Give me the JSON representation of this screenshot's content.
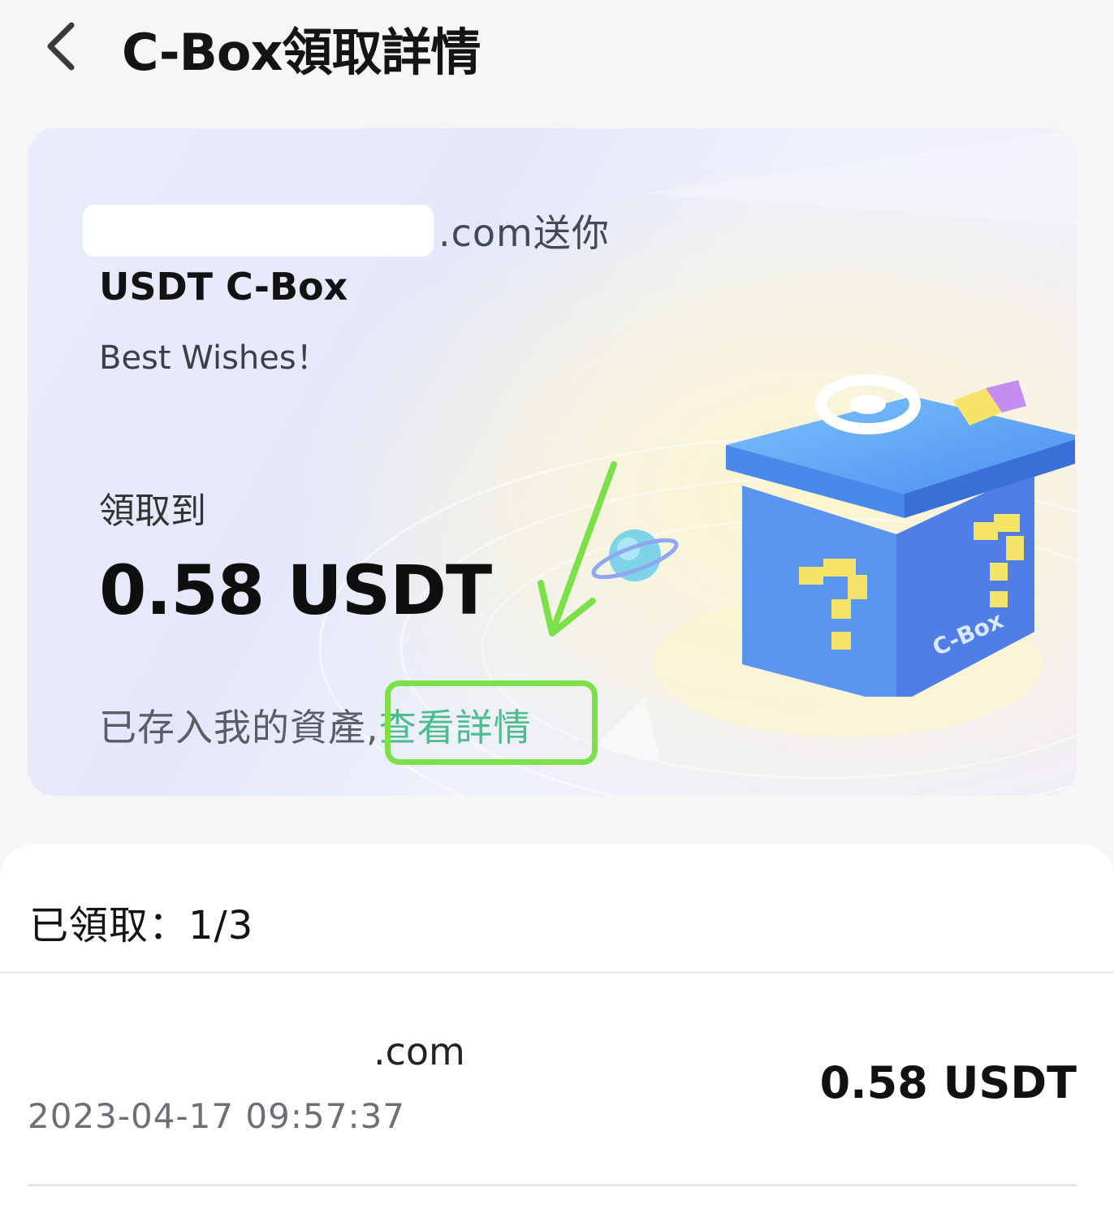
{
  "header": {
    "title": "C-Box領取詳情",
    "back_icon": "chevron-left-icon"
  },
  "card": {
    "sender_suffix": ".com送你",
    "box_title": "USDT C-Box",
    "wish": "Best Wishes！",
    "received_label": "領取到",
    "received_amount": "0.58 USDT",
    "deposit_text": "已存入我的資產,",
    "details_link": "查看詳情",
    "box_badge_text": "C-Box",
    "colors": {
      "link": "#4bbd8f",
      "highlight": "#7be04a",
      "arrow": "#7be04a"
    }
  },
  "claims": {
    "summary": "已領取：1/3",
    "records": [
      {
        "name": ".com",
        "time": "2023-04-17 09:57:37",
        "amount": "0.58 USDT"
      }
    ]
  }
}
